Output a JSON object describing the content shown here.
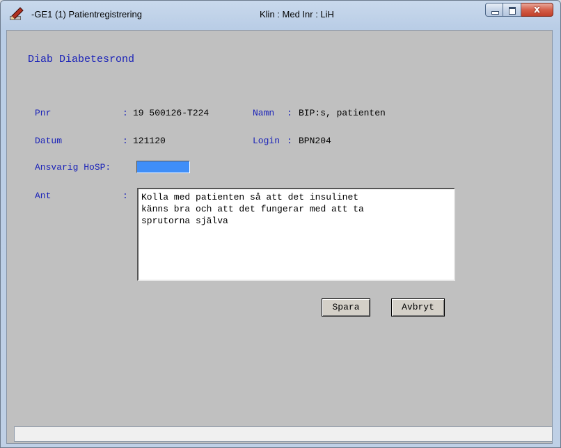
{
  "window": {
    "title": "-GE1 (1) Patientregistrering",
    "context": "Klin : Med  Inr : LiH"
  },
  "form": {
    "title": "Diab Diabetesrond",
    "pnr": {
      "label": "Pnr",
      "colon": ":",
      "value": "19 500126-T224"
    },
    "namn": {
      "label": "Namn",
      "colon": ":",
      "value": "BIP:s, patienten"
    },
    "datum": {
      "label": "Datum",
      "colon": ":",
      "value": "121120"
    },
    "login": {
      "label": "Login",
      "colon": ":",
      "value": "BPN204"
    },
    "hosp": {
      "label": "Ansvarig HoSP:",
      "value": ""
    },
    "ant": {
      "label": "Ant",
      "colon": ":",
      "value": "Kolla med patienten så att det insulinet\nkänns bra och att det fungerar med att ta\nsprutorna själva"
    }
  },
  "buttons": {
    "save": {
      "label": "Spara"
    },
    "cancel": {
      "label": "Avbryt"
    }
  },
  "status": {
    "text": ""
  },
  "colors": {
    "label": "#1a22b8",
    "field_highlight": "#3f8ef8",
    "client_bg": "#c0c0c0"
  }
}
